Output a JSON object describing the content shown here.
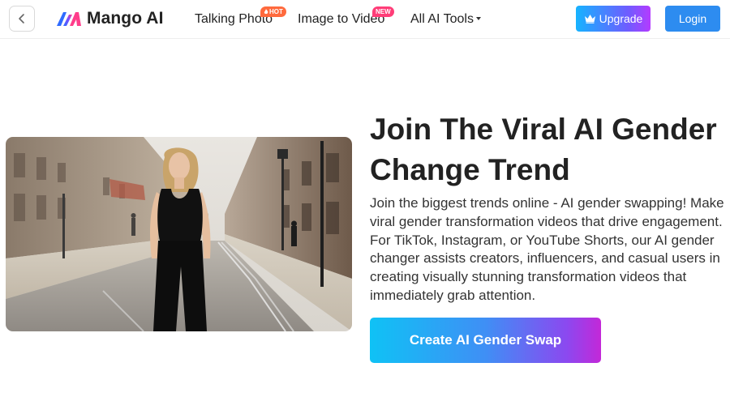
{
  "header": {
    "logo_text": "Mango AI",
    "nav": [
      {
        "label": "Talking Photo",
        "badge": "HOT"
      },
      {
        "label": "Image to Video",
        "badge": "NEW"
      },
      {
        "label": "All AI Tools"
      }
    ],
    "upgrade_label": "Upgrade",
    "login_label": "Login"
  },
  "hero": {
    "headline": "Join The Viral AI Gender Change Trend",
    "description": "Join the biggest trends online - AI gender swapping! Make viral gender transformation videos that drive engagement. For TikTok, Instagram, or YouTube Shorts, our AI gender changer assists creators, influencers, and casual users in creating visually stunning transformation videos that immediately grab attention.",
    "cta_label": "Create AI Gender Swap"
  },
  "colors": {
    "login_blue": "#2d8cf0",
    "hot_badge": "#ff6a3d",
    "new_badge": "#ff3d78",
    "text_dark": "#222222"
  },
  "icons": [
    "chevron-left-icon",
    "mango-logo-icon",
    "flame-icon",
    "crown-icon",
    "caret-down-icon"
  ]
}
